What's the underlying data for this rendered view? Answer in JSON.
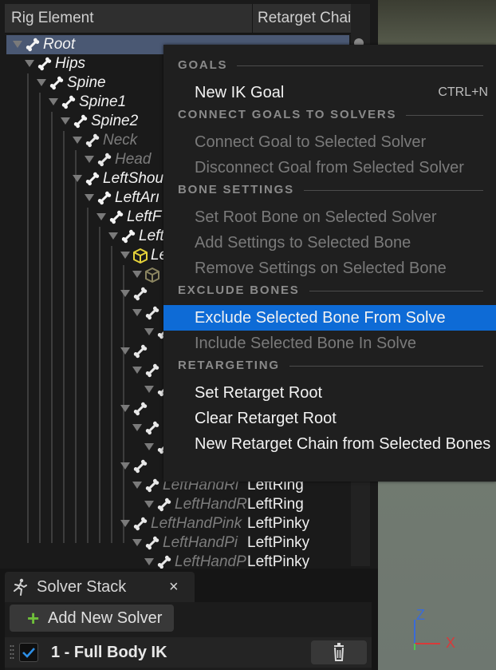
{
  "hierarchy": {
    "columns": [
      "Rig Element",
      "Retarget Chai"
    ],
    "rows": [
      {
        "name": "Root",
        "chain": "",
        "icon": "bone",
        "level": 0,
        "selected": true,
        "active": true
      },
      {
        "name": "Hips",
        "chain": "",
        "icon": "bone",
        "level": 1,
        "active": true
      },
      {
        "name": "Spine",
        "chain": "",
        "icon": "bone",
        "level": 2,
        "active": true
      },
      {
        "name": "Spine1",
        "chain": "",
        "icon": "bone",
        "level": 3,
        "active": true
      },
      {
        "name": "Spine2",
        "chain": "",
        "icon": "bone",
        "level": 4,
        "active": true
      },
      {
        "name": "Neck",
        "chain": "",
        "icon": "bone",
        "level": 5,
        "active": false
      },
      {
        "name": "Head",
        "chain": "",
        "icon": "bone",
        "level": 6,
        "active": false
      },
      {
        "name": "LeftShou",
        "chain": "",
        "icon": "bone",
        "level": 5,
        "active": true
      },
      {
        "name": "LeftArı",
        "chain": "",
        "icon": "bone",
        "level": 6,
        "active": true
      },
      {
        "name": "LeftF",
        "chain": "",
        "icon": "bone",
        "level": 7,
        "active": true
      },
      {
        "name": "Left",
        "chain": "",
        "icon": "bone",
        "level": 8,
        "active": true
      },
      {
        "name": "Le",
        "chain": "",
        "icon": "goal-cube",
        "level": 9,
        "active": true
      },
      {
        "name": "",
        "chain": "",
        "icon": "goal-cube-dim",
        "level": 10,
        "active": false
      },
      {
        "name": "",
        "chain": "",
        "icon": "bone",
        "level": 9,
        "active": false
      },
      {
        "name": "",
        "chain": "",
        "icon": "bone",
        "level": 10,
        "active": false
      },
      {
        "name": "",
        "chain": "",
        "icon": "bone",
        "level": 11,
        "active": false
      },
      {
        "name": "",
        "chain": "",
        "icon": "bone",
        "level": 9,
        "active": false
      },
      {
        "name": "",
        "chain": "",
        "icon": "bone",
        "level": 10,
        "active": false
      },
      {
        "name": "",
        "chain": "",
        "icon": "bone",
        "level": 11,
        "active": false
      },
      {
        "name": "",
        "chain": "",
        "icon": "bone",
        "level": 9,
        "active": false
      },
      {
        "name": "",
        "chain": "",
        "icon": "bone",
        "level": 10,
        "active": false
      },
      {
        "name": "",
        "chain": "",
        "icon": "bone",
        "level": 11,
        "active": false
      },
      {
        "name": "",
        "chain": "",
        "icon": "bone",
        "level": 9,
        "active": false
      },
      {
        "name": "LeftHandRi",
        "chain": "LeftRing",
        "icon": "bone",
        "level": 10,
        "active": false
      },
      {
        "name": "LeftHandR",
        "chain": "LeftRing",
        "icon": "bone",
        "level": 11,
        "active": false
      },
      {
        "name": "LeftHandPink",
        "chain": "LeftPinky",
        "icon": "bone",
        "level": 9,
        "active": false
      },
      {
        "name": "LeftHandPi",
        "chain": "LeftPinky",
        "icon": "bone",
        "level": 10,
        "active": false
      },
      {
        "name": "LeftHandP",
        "chain": "LeftPinky",
        "icon": "bone",
        "level": 11,
        "active": false
      }
    ]
  },
  "context_menu": {
    "sections": [
      {
        "title": "GOALS",
        "items": [
          {
            "label": "New IK Goal",
            "shortcut": "CTRL+N",
            "enabled": true
          }
        ]
      },
      {
        "title": "CONNECT GOALS TO SOLVERS",
        "items": [
          {
            "label": "Connect Goal to Selected Solver",
            "enabled": false
          },
          {
            "label": "Disconnect Goal from Selected Solver",
            "enabled": false
          }
        ]
      },
      {
        "title": "BONE SETTINGS",
        "items": [
          {
            "label": "Set Root Bone on Selected Solver",
            "enabled": false
          },
          {
            "label": "Add Settings to Selected Bone",
            "enabled": false
          },
          {
            "label": "Remove Settings on Selected Bone",
            "enabled": false
          }
        ]
      },
      {
        "title": "EXCLUDE BONES",
        "items": [
          {
            "label": "Exclude Selected Bone From Solve",
            "enabled": true,
            "highlighted": true
          },
          {
            "label": "Include Selected Bone In Solve",
            "enabled": false
          }
        ]
      },
      {
        "title": "RETARGETING",
        "items": [
          {
            "label": "Set Retarget Root",
            "enabled": true
          },
          {
            "label": "Clear Retarget Root",
            "enabled": true
          },
          {
            "label": "New Retarget Chain from Selected Bones",
            "enabled": true
          }
        ]
      }
    ]
  },
  "solver_stack": {
    "title": "Solver Stack",
    "close_label": "×",
    "add_label": "Add New Solver",
    "solvers": [
      {
        "label": "1 - Full Body IK",
        "enabled": true
      }
    ]
  },
  "viewport_axes": {
    "x": "X",
    "z": "Z"
  },
  "colors": {
    "accent": "#0e6bd6",
    "selection": "#4a5873",
    "axis_x": "#d83a3a",
    "axis_z": "#3a6bd8",
    "axis_y": "#4ec94e",
    "goal_cube": "#e5d23a"
  }
}
